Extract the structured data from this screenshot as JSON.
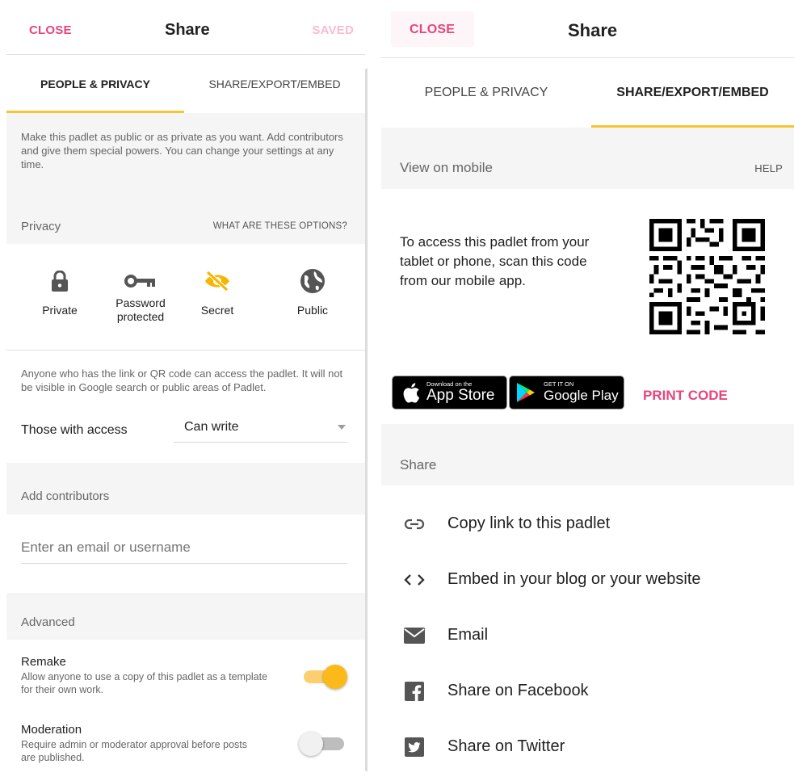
{
  "left": {
    "header": {
      "close_label": "CLOSE",
      "title": "Share",
      "saved_label": "SAVED"
    },
    "tabs": [
      {
        "label": "PEOPLE & PRIVACY",
        "active": true
      },
      {
        "label": "SHARE/EXPORT/EMBED",
        "active": false
      }
    ],
    "intro": "Make this padlet as public or as private as you want. Add contributors and give them special powers. You can change your settings at any time.",
    "privacy": {
      "title": "Privacy",
      "help_link": "WHAT ARE THESE OPTIONS?",
      "options": [
        {
          "label": "Private",
          "icon": "lock-icon",
          "selected": false
        },
        {
          "label": "Password protected",
          "icon": "key-icon",
          "selected": false
        },
        {
          "label": "Secret",
          "icon": "eye-off-icon",
          "selected": true
        },
        {
          "label": "Public",
          "icon": "globe-icon",
          "selected": false
        }
      ],
      "description": "Anyone who has the link or QR code can access the padlet. It will not be visible in Google search or public areas of Padlet."
    },
    "access": {
      "label": "Those with access",
      "value": "Can write"
    },
    "contributors": {
      "title": "Add contributors",
      "placeholder": "Enter an email or username"
    },
    "advanced": {
      "title": "Advanced",
      "remake": {
        "title": "Remake",
        "description": "Allow anyone to use a copy of this padlet as a template for their own work.",
        "enabled": true
      },
      "moderation": {
        "title": "Moderation",
        "description": "Require admin or moderator approval before posts are published.",
        "enabled": false
      }
    }
  },
  "right": {
    "header": {
      "close_label": "CLOSE",
      "title": "Share"
    },
    "tabs": [
      {
        "label": "PEOPLE & PRIVACY",
        "active": false
      },
      {
        "label": "SHARE/EXPORT/EMBED",
        "active": true
      }
    ],
    "mobile": {
      "title": "View on mobile",
      "help_link": "HELP",
      "text": "To access this padlet from your tablet or phone, scan this code from our mobile app.",
      "app_store": {
        "small": "Download on the",
        "big": "App Store"
      },
      "google_play": {
        "small": "GET IT ON",
        "big": "Google Play"
      },
      "print_label": "PRINT CODE"
    },
    "share": {
      "title": "Share",
      "items": [
        {
          "label": "Copy link to this padlet",
          "icon": "link-icon"
        },
        {
          "label": "Embed in your blog or your website",
          "icon": "code-icon"
        },
        {
          "label": "Email",
          "icon": "mail-icon"
        },
        {
          "label": "Share on Facebook",
          "icon": "facebook-icon"
        },
        {
          "label": "Share on Twitter",
          "icon": "twitter-icon"
        }
      ]
    }
  },
  "colors": {
    "accent_pink": "#e8457b",
    "accent_yellow": "#f7c433",
    "toggle_on": "#fbb91a",
    "secret_icon": "#f7b500"
  }
}
